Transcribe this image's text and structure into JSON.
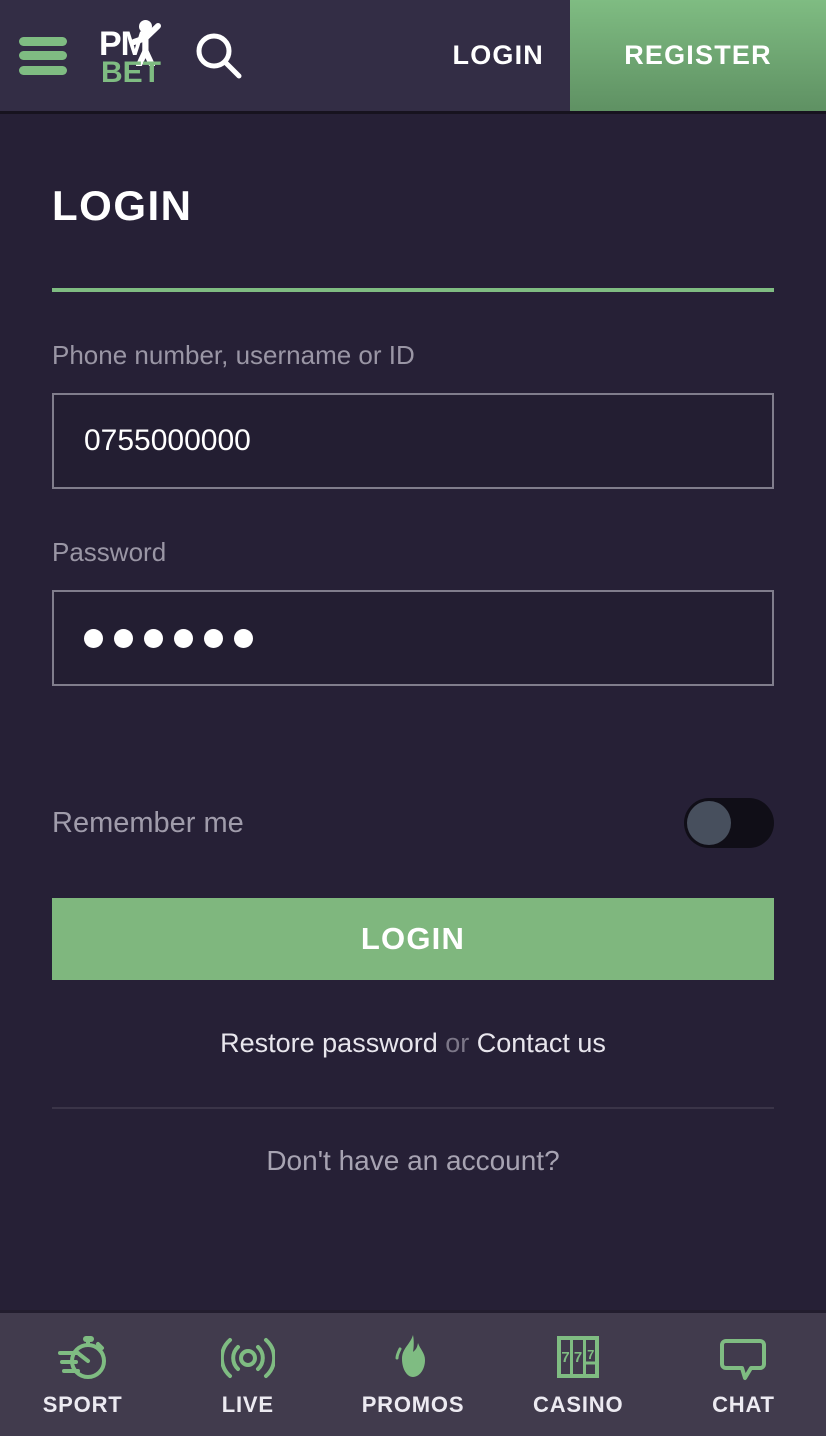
{
  "header": {
    "menu_icon": "hamburger-menu-icon",
    "logo": {
      "primary": "PM",
      "secondary": "BET",
      "figure_icon": "person-figure-icon"
    },
    "search_icon": "search-icon",
    "login_label": "LOGIN",
    "register_label": "REGISTER",
    "register_color": "#7FBC82",
    "background": "#332D45"
  },
  "main": {
    "page_title": "LOGIN",
    "accent_color": "#7FBC82",
    "background": "#262036",
    "username_field": {
      "label": "Phone number, username or ID",
      "value": "0755000000",
      "placeholder": ""
    },
    "password_field": {
      "label": "Password",
      "value": "••••••",
      "dot_count": 6,
      "placeholder": ""
    },
    "remember": {
      "label": "Remember me",
      "state": "off"
    },
    "login_button": "LOGIN",
    "links": {
      "restore": "Restore password",
      "separator": "or",
      "contact": "Contact us"
    },
    "no_account_text": "Don't have an account?"
  },
  "bottomnav": {
    "background": "#413B4D",
    "icon_color": "#7FBC82",
    "items": [
      {
        "label": "SPORT",
        "icon": "stopwatch-icon"
      },
      {
        "label": "LIVE",
        "icon": "broadcast-waves-icon"
      },
      {
        "label": "PROMOS",
        "icon": "flame-icon"
      },
      {
        "label": "CASINO",
        "icon": "slot-machine-777-icon"
      },
      {
        "label": "CHAT",
        "icon": "speech-bubble-icon"
      }
    ]
  }
}
